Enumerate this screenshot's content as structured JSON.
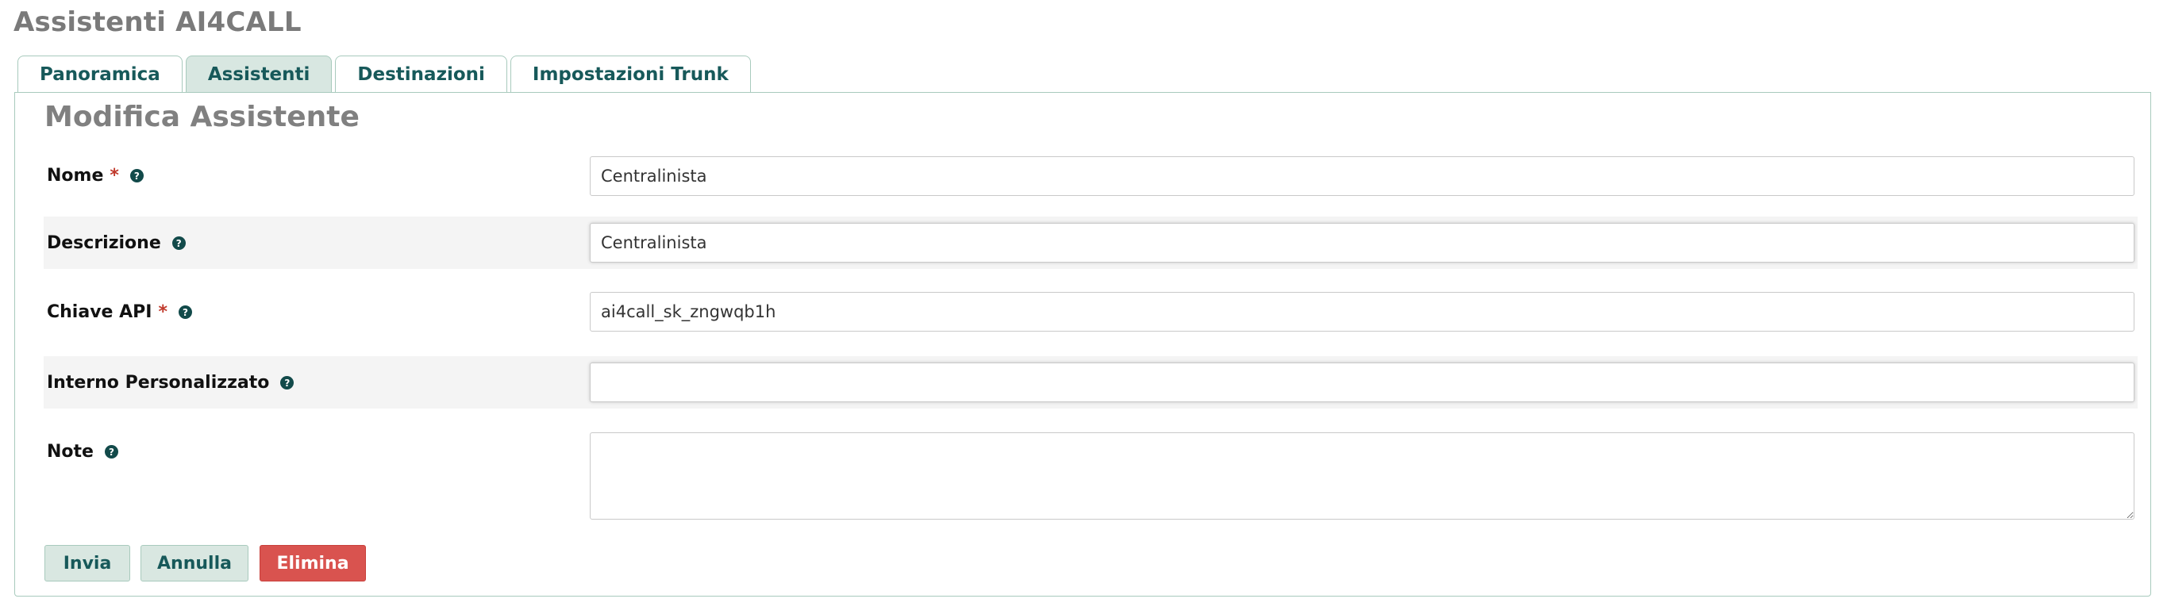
{
  "page": {
    "title": "Assistenti AI4CALL"
  },
  "tabs": [
    {
      "label": "Panoramica",
      "active": false
    },
    {
      "label": "Assistenti",
      "active": true
    },
    {
      "label": "Destinazioni",
      "active": false
    },
    {
      "label": "Impostazioni Trunk",
      "active": false
    }
  ],
  "form": {
    "title": "Modifica Assistente",
    "required_marker": "*",
    "help_icon": "?",
    "fields": {
      "nome": {
        "label": "Nome",
        "required": true,
        "value": "Centralinista"
      },
      "descrizione": {
        "label": "Descrizione",
        "required": false,
        "value": "Centralinista"
      },
      "chiave_api": {
        "label": "Chiave API",
        "required": true,
        "value": "ai4call_sk_zngwqb1h"
      },
      "interno": {
        "label": "Interno Personalizzato",
        "required": false,
        "value": ""
      },
      "note": {
        "label": "Note",
        "required": false,
        "value": ""
      }
    },
    "buttons": {
      "submit": "Invia",
      "cancel": "Annulla",
      "delete": "Elimina"
    }
  },
  "colors": {
    "accent": "#17595a",
    "tab_active_bg": "#d8e7e1",
    "border": "#a8cabd",
    "danger": "#d9534f",
    "required": "#c0392b",
    "row_alt_bg": "#f4f4f4"
  },
  "icons": {
    "help": "question-circle-icon"
  }
}
